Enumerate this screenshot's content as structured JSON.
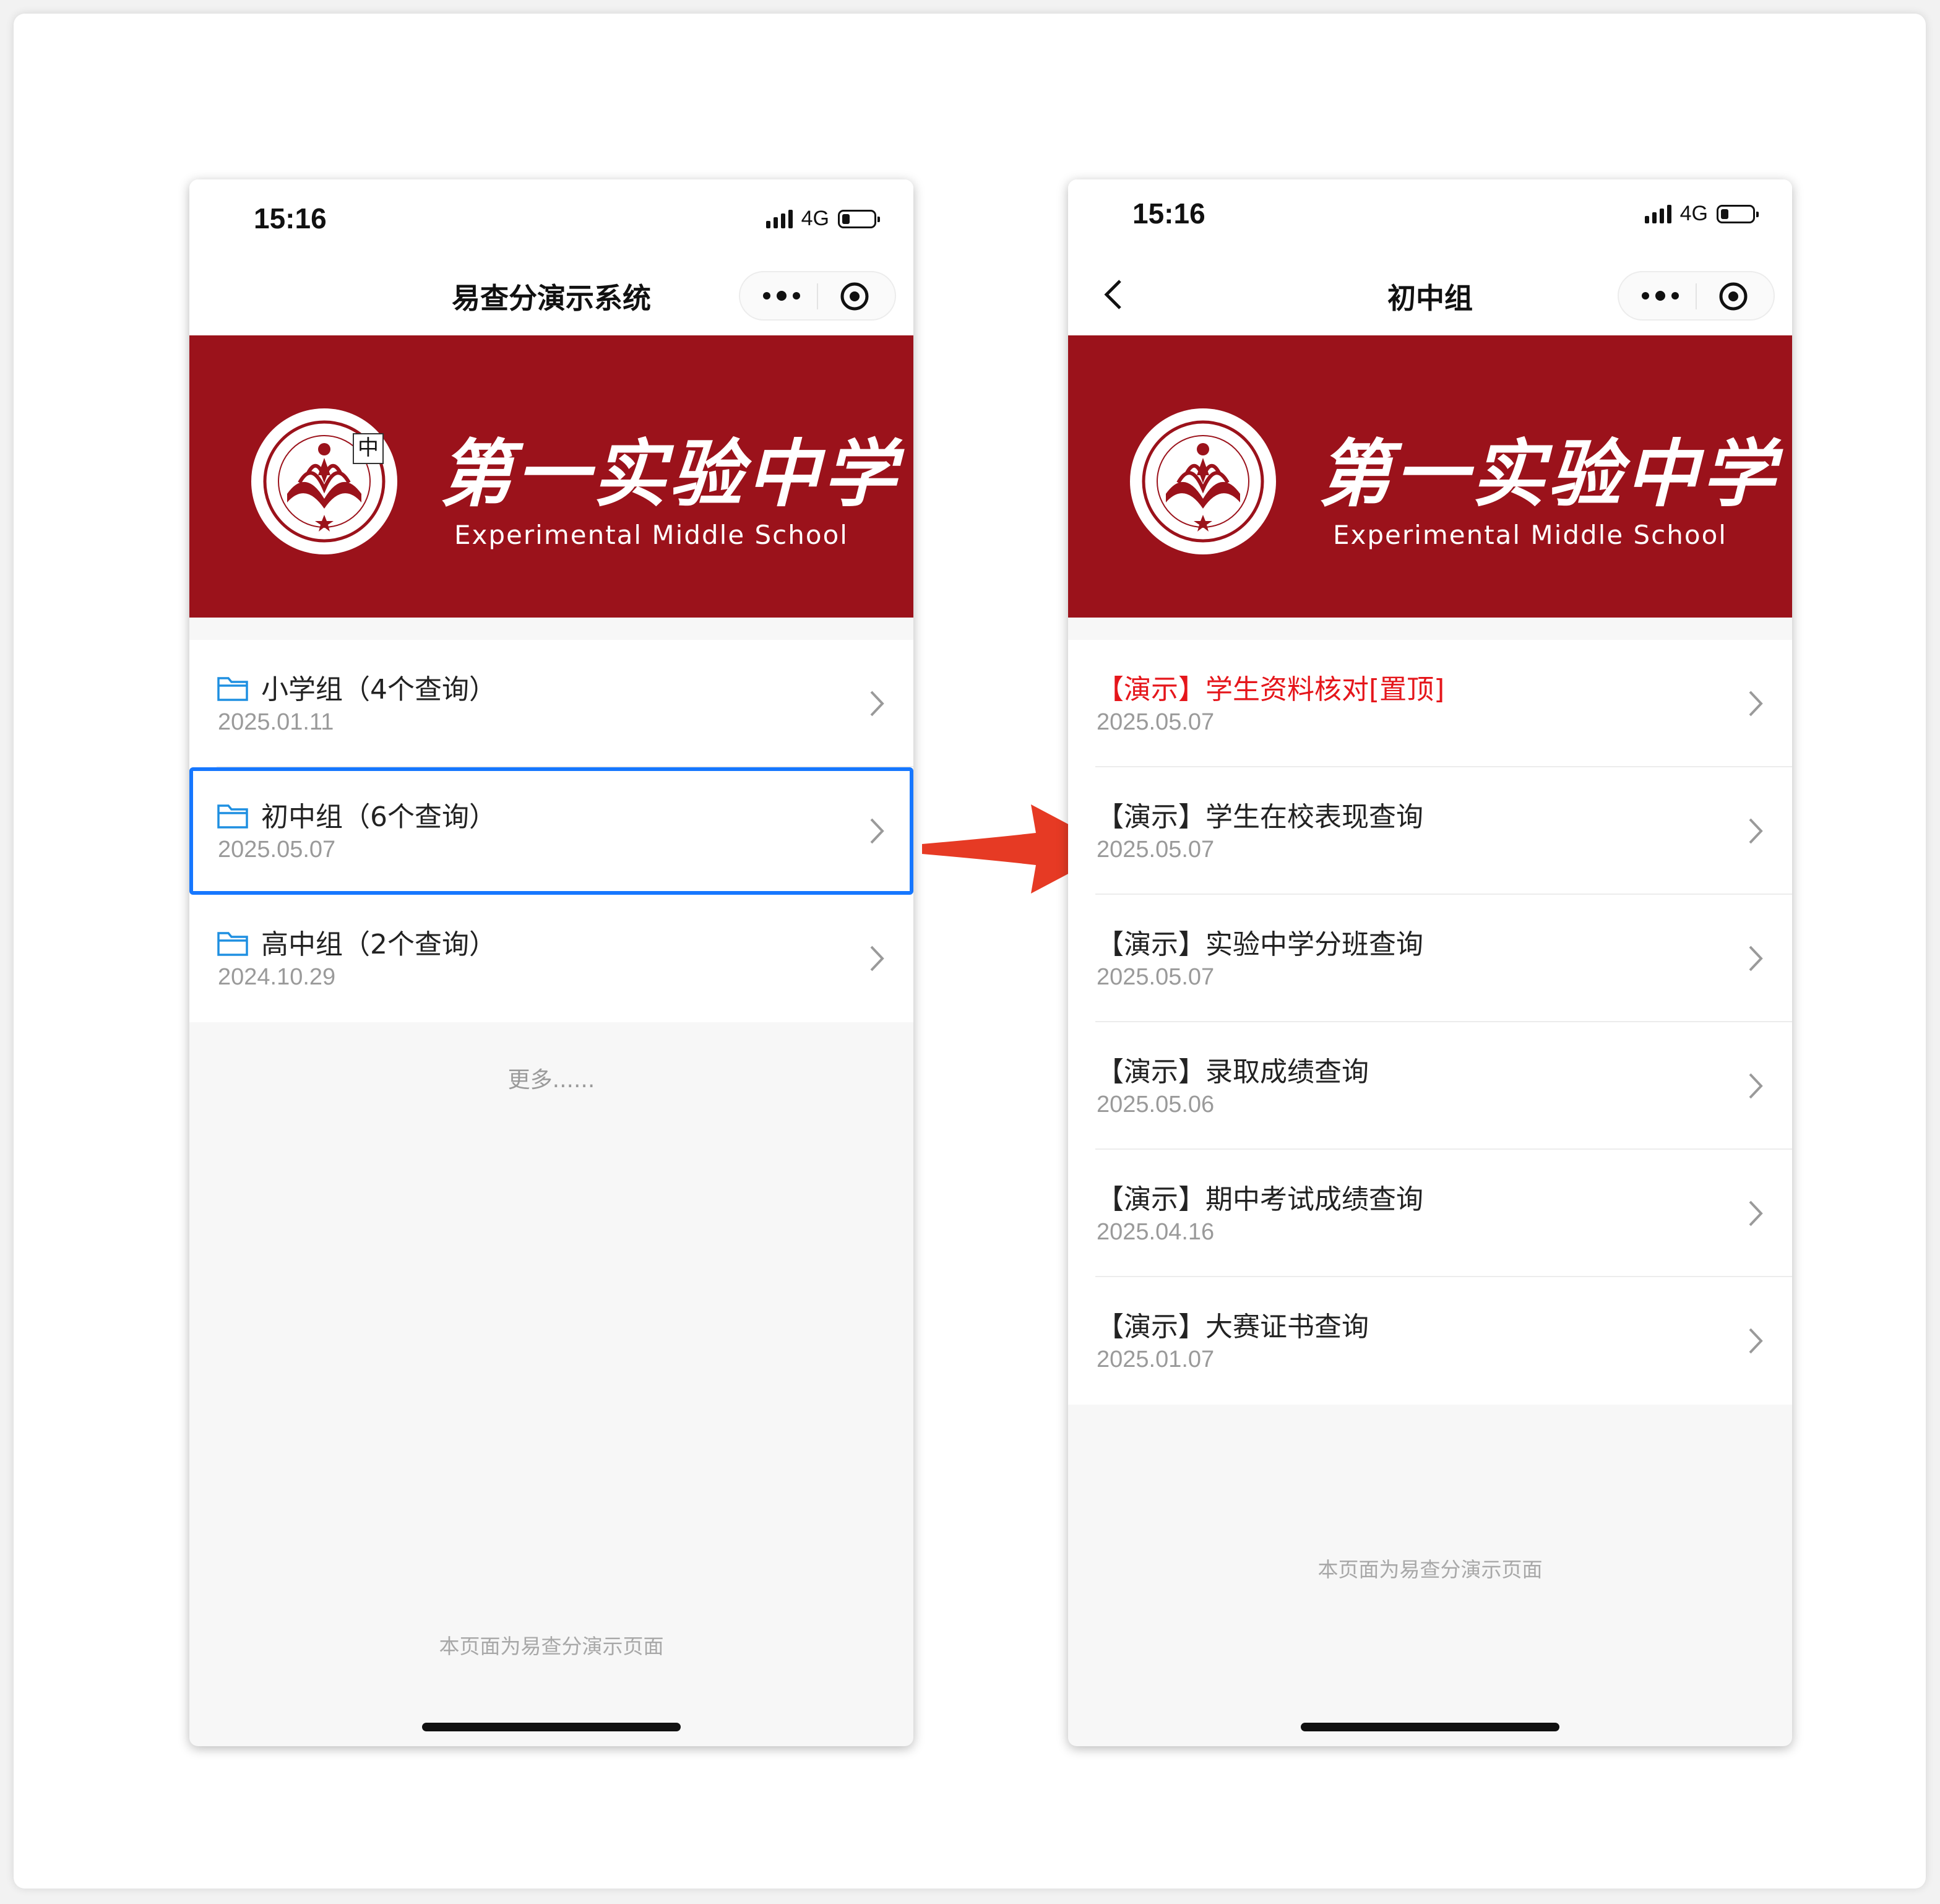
{
  "colors": {
    "banner_red": "#9b121b",
    "selected_blue": "#1677ff",
    "pinned_red": "#e5161b",
    "arrow_red": "#e63a24",
    "folder_blue": "#1e8fe1"
  },
  "left_screen": {
    "status": {
      "time": "15:16",
      "network": "4G",
      "battery_level": 0.25
    },
    "nav": {
      "title": "易查分演示系统"
    },
    "banner": {
      "school_cn": "第一实验中学",
      "school_en": "Experimental Middle School",
      "ime_char": "中"
    },
    "groups": [
      {
        "title": "小学组（4个查询）",
        "date": "2025.01.11",
        "icon": "folder-icon",
        "selected": false
      },
      {
        "title": "初中组（6个查询）",
        "date": "2025.05.07",
        "icon": "folder-icon",
        "selected": true
      },
      {
        "title": "高中组（2个查询）",
        "date": "2024.10.29",
        "icon": "folder-icon",
        "selected": false
      }
    ],
    "more_label": "更多......",
    "footer": "本页面为易查分演示页面"
  },
  "right_screen": {
    "status": {
      "time": "15:16",
      "network": "4G",
      "battery_level": 0.25
    },
    "nav": {
      "title": "初中组"
    },
    "banner": {
      "school_cn": "第一实验中学",
      "school_en": "Experimental Middle School"
    },
    "queries": [
      {
        "title": "【演示】学生资料核对[置顶]",
        "date": "2025.05.07",
        "pinned": true
      },
      {
        "title": "【演示】学生在校表现查询",
        "date": "2025.05.07",
        "pinned": false
      },
      {
        "title": "【演示】实验中学分班查询",
        "date": "2025.05.07",
        "pinned": false
      },
      {
        "title": "【演示】录取成绩查询",
        "date": "2025.05.06",
        "pinned": false
      },
      {
        "title": "【演示】期中考试成绩查询",
        "date": "2025.04.16",
        "pinned": false
      },
      {
        "title": "【演示】大赛证书查询",
        "date": "2025.01.07",
        "pinned": false
      }
    ],
    "footer": "本页面为易查分演示页面"
  }
}
